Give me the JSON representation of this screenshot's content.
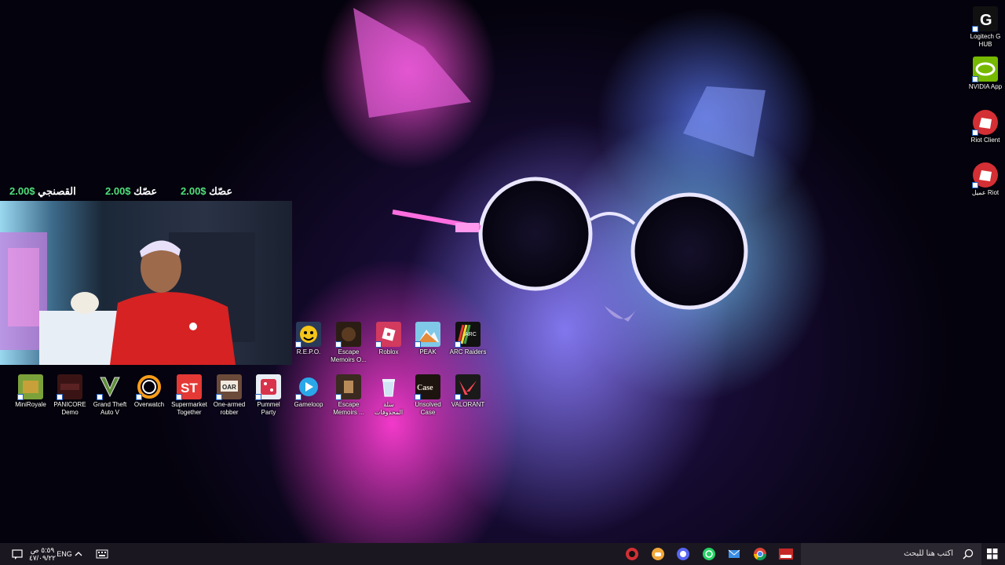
{
  "colors": {
    "taskbar_bg": "#1b1720",
    "donation_amount": "#4fe07a",
    "desktop_bg": "#04020c"
  },
  "overlay": {
    "donations": [
      {
        "name": "القصنجي",
        "amount": "2.00$"
      },
      {
        "name": "عصّك",
        "amount": "2.00$"
      },
      {
        "name": "عصّك",
        "amount": "2.00$"
      }
    ]
  },
  "desktop_icons": {
    "right_column": [
      {
        "label": "Logitech G HUB",
        "icon": "logitech-g-icon"
      },
      {
        "label": "NVIDIA App",
        "icon": "nvidia-icon"
      },
      {
        "label": "Riot Client",
        "icon": "riot-icon"
      },
      {
        "label": "عميل Riot",
        "icon": "riot-icon"
      }
    ],
    "row_upper": [
      {
        "label": "R.E.P.O.",
        "icon": "repo-icon"
      },
      {
        "label": "Escape Memoirs O...",
        "icon": "escape-memoirs-icon"
      },
      {
        "label": "Roblox",
        "icon": "roblox-icon"
      },
      {
        "label": "PEAK",
        "icon": "peak-icon"
      },
      {
        "label": "ARC Raiders",
        "icon": "arc-raiders-icon"
      }
    ],
    "row_lower": [
      {
        "label": "MiniRoyale",
        "icon": "miniroyale-icon"
      },
      {
        "label": "PANICORE Demo",
        "icon": "panicore-icon"
      },
      {
        "label": "Grand Theft Auto V",
        "icon": "gta-icon"
      },
      {
        "label": "Overwatch",
        "icon": "overwatch-icon"
      },
      {
        "label": "Supermarket Together",
        "icon": "supermarket-icon"
      },
      {
        "label": "One-armed robber",
        "icon": "one-armed-robber-icon"
      },
      {
        "label": "Pummel Party",
        "icon": "pummel-party-icon"
      },
      {
        "label": "Gameloop",
        "icon": "gameloop-icon"
      },
      {
        "label": "Escape Memoirs ...",
        "icon": "escape-memoirs-icon"
      },
      {
        "label": "سلة المحذوفات",
        "icon": "recycle-bin-icon"
      },
      {
        "label": "Unsolved Case",
        "icon": "unsolved-case-icon"
      },
      {
        "label": "VALORANT",
        "icon": "valorant-icon"
      }
    ]
  },
  "taskbar": {
    "search_placeholder": "اكتب هنا للبحث",
    "clock_time": "٥:٥٩ ص",
    "clock_date": "٤٧/٠٩/٢٢",
    "language": "ENG",
    "pinned": [
      "riot-icon",
      "discord-yellow-icon",
      "obs-icon",
      "whatsapp-icon",
      "mail-icon",
      "chrome-icon",
      "game-icon",
      "explorer-icon"
    ]
  }
}
